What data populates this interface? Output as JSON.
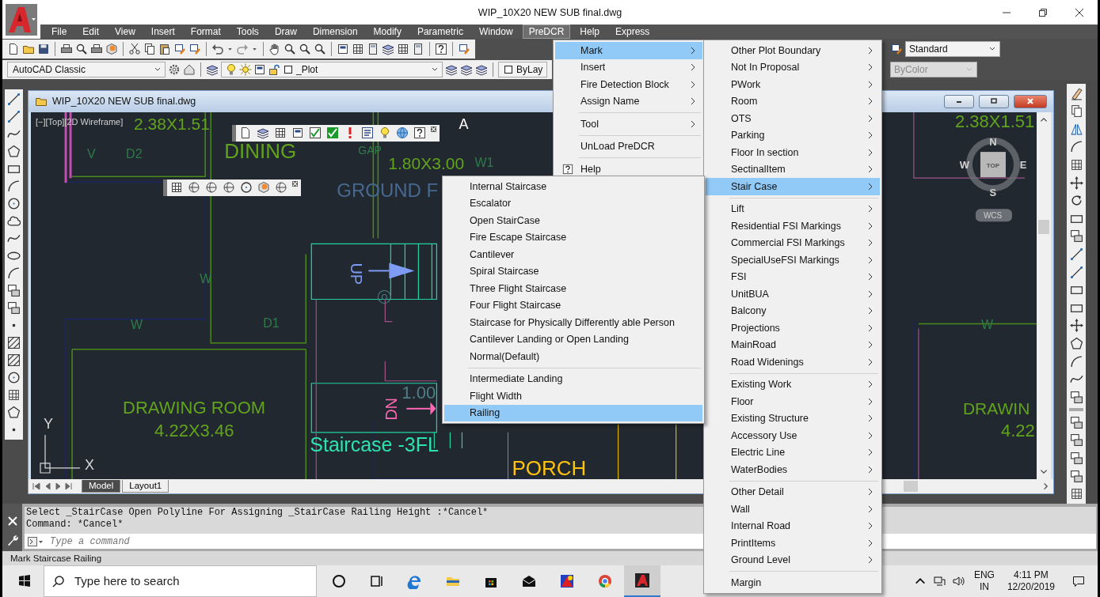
{
  "window": {
    "title": "WIP_10X20 NEW SUB final.dwg"
  },
  "menu_bar": [
    {
      "label": "File",
      "selected": false
    },
    {
      "label": "Edit",
      "selected": false
    },
    {
      "label": "View",
      "selected": false
    },
    {
      "label": "Insert",
      "selected": false
    },
    {
      "label": "Format",
      "selected": false
    },
    {
      "label": "Tools",
      "selected": false
    },
    {
      "label": "Draw",
      "selected": false
    },
    {
      "label": "Dimension",
      "selected": false
    },
    {
      "label": "Modify",
      "selected": false
    },
    {
      "label": "Parametric",
      "selected": false
    },
    {
      "label": "Window",
      "selected": false
    },
    {
      "label": "PreDCR",
      "selected": true
    },
    {
      "label": "Help",
      "selected": false
    },
    {
      "label": "Express",
      "selected": false
    }
  ],
  "toolbar": {
    "workspace": "AutoCAD Classic",
    "layer": "_Plot",
    "color_control": "ByLay",
    "text_style": "Standard",
    "plot_style": {
      "value": "ByColor",
      "disabled": true
    }
  },
  "drawing_window": {
    "title": "WIP_10X20 NEW SUB final.dwg",
    "viewport_label": "[−][Top][2D Wireframe]",
    "labels": [
      {
        "text": "2.38X1.51",
        "color": "#62a31c"
      },
      {
        "text": "A",
        "color": "#ffffff"
      },
      {
        "text": "V",
        "color": "#2f7a4a"
      },
      {
        "text": "D2",
        "color": "#2f7a4a"
      },
      {
        "text": "DINING",
        "color": "#62a31c"
      },
      {
        "text": "GAP",
        "color": "#2f7a4a"
      },
      {
        "text": "1.80X3.00",
        "color": "#62a31c"
      },
      {
        "text": "W1",
        "color": "#2f7a4a"
      },
      {
        "text": "GROUND F",
        "color": "#47688f"
      },
      {
        "text": "W",
        "color": "#2f7a4a"
      },
      {
        "text": "UP",
        "color": "#7f9cf5"
      },
      {
        "text": "W",
        "color": "#2f7a4a"
      },
      {
        "text": "D1",
        "color": "#2f7a4a"
      },
      {
        "text": "1.00",
        "color": "#4f7f86"
      },
      {
        "text": "DN",
        "color": "#ff69b4"
      },
      {
        "text": "DRAWING ROOM",
        "color": "#62a31c"
      },
      {
        "text": "4.22X3.46",
        "color": "#62a31c"
      },
      {
        "text": "Staircase -3FL",
        "color": "#2de2b1"
      },
      {
        "text": "PORCH",
        "color": "#ffc20e"
      },
      {
        "text": "2.38X1.51",
        "color": "#62a31c"
      },
      {
        "text": "W",
        "color": "#2f7a4a"
      },
      {
        "text": "DRAWIN",
        "color": "#62a31c"
      },
      {
        "text": "4.22",
        "color": "#62a31c"
      },
      {
        "text": "Y",
        "color": "#d8d8d8"
      },
      {
        "text": "X",
        "color": "#d8d8d8"
      }
    ],
    "view_cube": {
      "north": "N",
      "west": "W",
      "east": "E",
      "south": "S",
      "face": "TOP",
      "ucs": "WCS"
    },
    "tabs": [
      {
        "label": "Model",
        "selected": true
      },
      {
        "label": "Layout1",
        "selected": false
      }
    ]
  },
  "predcr_menu": {
    "groups": [
      [
        {
          "label": "Mark",
          "kind": "submenu",
          "selected": true
        },
        {
          "label": "Insert",
          "kind": "submenu",
          "selected": false
        },
        {
          "label": "Fire Detection Block",
          "kind": "submenu",
          "selected": false
        },
        {
          "label": "Assign Name",
          "kind": "submenu",
          "selected": false
        }
      ],
      [
        {
          "label": "Tool",
          "kind": "submenu",
          "selected": false
        }
      ],
      [
        {
          "label": "UnLoad PreDCR",
          "kind": "command",
          "selected": false
        }
      ],
      [
        {
          "label": "Help",
          "kind": "help",
          "selected": false
        }
      ]
    ]
  },
  "mark_menu": {
    "groups": [
      [
        {
          "label": "Other Plot Boundary",
          "kind": "submenu",
          "selected": false
        },
        {
          "label": "Not In Proposal",
          "kind": "submenu",
          "selected": false
        },
        {
          "label": "PWork",
          "kind": "submenu",
          "selected": false
        },
        {
          "label": "Room",
          "kind": "submenu",
          "selected": false
        },
        {
          "label": "OTS",
          "kind": "submenu",
          "selected": false
        },
        {
          "label": "Parking",
          "kind": "submenu",
          "selected": false
        },
        {
          "label": "Floor In section",
          "kind": "submenu",
          "selected": false
        },
        {
          "label": "SectinalItem",
          "kind": "submenu",
          "selected": false
        },
        {
          "label": "Stair Case",
          "kind": "submenu",
          "selected": true
        }
      ],
      [
        {
          "label": "Lift",
          "kind": "submenu",
          "selected": false
        },
        {
          "label": "Residential FSI Markings",
          "kind": "submenu",
          "selected": false
        },
        {
          "label": "Commercial FSI Markings",
          "kind": "submenu",
          "selected": false
        },
        {
          "label": "SpecialUseFSI Markings",
          "kind": "submenu",
          "selected": false
        },
        {
          "label": "FSI",
          "kind": "submenu",
          "selected": false
        },
        {
          "label": "UnitBUA",
          "kind": "submenu",
          "selected": false
        },
        {
          "label": "Balcony",
          "kind": "submenu",
          "selected": false
        },
        {
          "label": "Projections",
          "kind": "submenu",
          "selected": false
        },
        {
          "label": "MainRoad",
          "kind": "submenu",
          "selected": false
        },
        {
          "label": "Road Widenings",
          "kind": "submenu",
          "selected": false
        }
      ],
      [
        {
          "label": "Existing Work",
          "kind": "submenu",
          "selected": false
        },
        {
          "label": "Floor",
          "kind": "submenu",
          "selected": false
        },
        {
          "label": "Existing Structure",
          "kind": "submenu",
          "selected": false
        },
        {
          "label": "Accessory Use",
          "kind": "submenu",
          "selected": false
        },
        {
          "label": "Electric Line",
          "kind": "submenu",
          "selected": false
        },
        {
          "label": "WaterBodies",
          "kind": "submenu",
          "selected": false
        }
      ],
      [
        {
          "label": "Other Detail",
          "kind": "submenu",
          "selected": false
        },
        {
          "label": "Wall",
          "kind": "submenu",
          "selected": false
        },
        {
          "label": "Internal Road",
          "kind": "submenu",
          "selected": false
        },
        {
          "label": "PrintItems",
          "kind": "submenu",
          "selected": false
        },
        {
          "label": "Ground Level",
          "kind": "submenu",
          "selected": false
        }
      ],
      [
        {
          "label": "Margin",
          "kind": "command",
          "selected": false
        }
      ]
    ]
  },
  "staircase_menu": {
    "groups": [
      [
        {
          "label": "Internal Staircase",
          "selected": false
        },
        {
          "label": "Escalator",
          "selected": false
        },
        {
          "label": "Open StairCase",
          "selected": false
        },
        {
          "label": "Fire Escape Staircase",
          "selected": false
        },
        {
          "label": "Cantilever",
          "selected": false
        },
        {
          "label": "Spiral Staircase",
          "selected": false
        },
        {
          "label": "Three Flight Staircase",
          "selected": false
        },
        {
          "label": "Four Flight Staircase",
          "selected": false
        },
        {
          "label": "Staircase for Physically Differently able Person",
          "selected": false
        },
        {
          "label": "Cantilever Landing or Open Landing",
          "selected": false
        },
        {
          "label": "Normal(Default)",
          "selected": false
        }
      ],
      [
        {
          "label": "Intermediate Landing",
          "selected": false
        },
        {
          "label": "Flight Width",
          "selected": false
        },
        {
          "label": "Railing",
          "selected": true
        }
      ]
    ]
  },
  "command_line": {
    "history": [
      "Select _StairCase Open Polyline For Assigning _StairCase Railing Height :*Cancel*",
      "Command: *Cancel*"
    ],
    "placeholder": "Type a command"
  },
  "status_bar": {
    "text": "Mark Staircase Railing"
  },
  "taskbar": {
    "search_placeholder": "Type here to search",
    "language": "ENG",
    "region": "IN",
    "time": "4:11 PM",
    "date": "12/20/2019"
  }
}
